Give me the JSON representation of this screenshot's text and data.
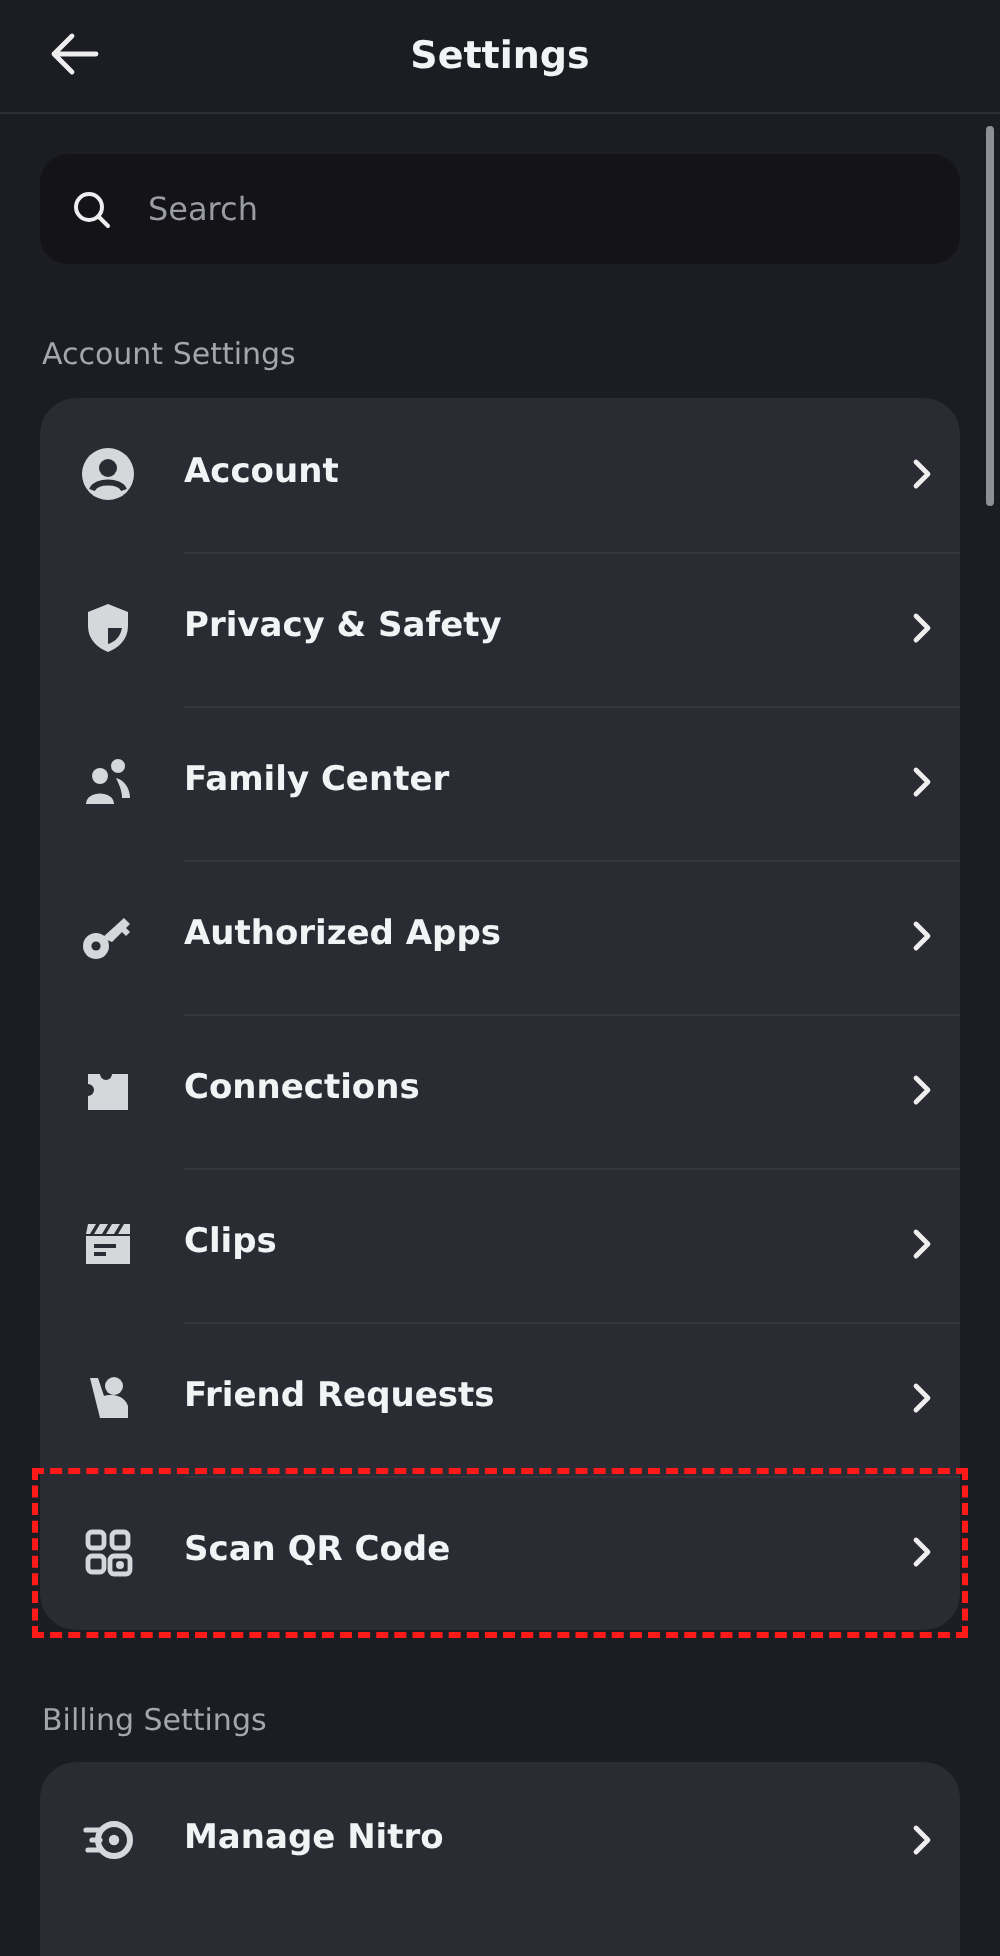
{
  "header": {
    "title": "Settings"
  },
  "search": {
    "placeholder": "Search"
  },
  "sections": [
    {
      "title": "Account Settings",
      "items": [
        {
          "label": "Account"
        },
        {
          "label": "Privacy & Safety"
        },
        {
          "label": "Family Center"
        },
        {
          "label": "Authorized Apps"
        },
        {
          "label": "Connections"
        },
        {
          "label": "Clips"
        },
        {
          "label": "Friend Requests"
        },
        {
          "label": "Scan QR Code",
          "highlighted": true
        }
      ]
    },
    {
      "title": "Billing Settings",
      "items": [
        {
          "label": "Manage Nitro"
        }
      ]
    }
  ]
}
